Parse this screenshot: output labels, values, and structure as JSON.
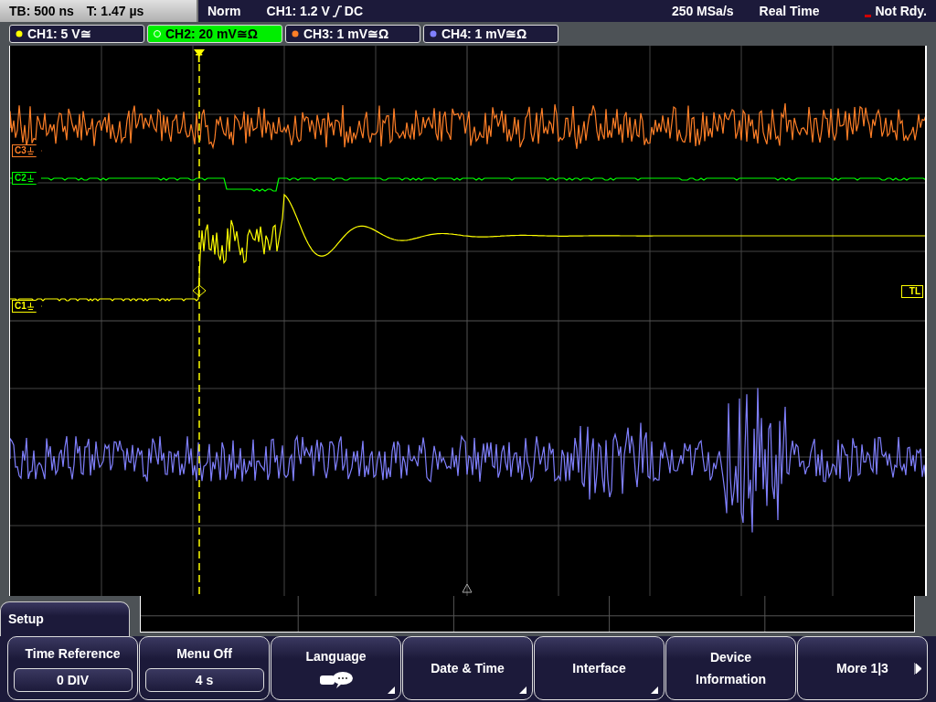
{
  "header": {
    "timebase": "TB: 500 ns",
    "trigger_time": "T: 1.47 µs",
    "mode": "Norm",
    "trigger_source": "CH1: 1.2 V",
    "trigger_coupling": "DC",
    "sample_rate": "250 MSa/s",
    "acquisition": "Real Time",
    "status": "Not Rdy."
  },
  "channels": [
    {
      "label": "CH1: 5 V≅",
      "color": "#ffff00",
      "selected": false
    },
    {
      "label": "CH2: 20 mV≅Ω",
      "color": "#00ff00",
      "selected": true
    },
    {
      "label": "CH3: 1 mV≅Ω",
      "color": "#ff7f27",
      "selected": false
    },
    {
      "label": "CH4: 1 mV≅Ω",
      "color": "#8080ff",
      "selected": false
    }
  ],
  "markers": [
    {
      "label": "C3",
      "color": "#ff7f27"
    },
    {
      "label": "C2",
      "color": "#00ff00"
    },
    {
      "label": "C1",
      "color": "#ffff00"
    }
  ],
  "trigger_marker": "T",
  "trigger_level_marker": "TL",
  "menu": {
    "title": "Setup",
    "buttons": [
      {
        "kind": "value",
        "label": "Time Reference",
        "value": "0 DIV"
      },
      {
        "kind": "value",
        "label": "Menu Off",
        "value": "4 s"
      },
      {
        "kind": "icon",
        "label": "Language"
      },
      {
        "kind": "submenu",
        "label": "Date & Time"
      },
      {
        "kind": "submenu",
        "label": "Interface"
      },
      {
        "kind": "plain",
        "label": "Device Information"
      },
      {
        "kind": "next",
        "label": "More 1|3"
      }
    ]
  }
}
